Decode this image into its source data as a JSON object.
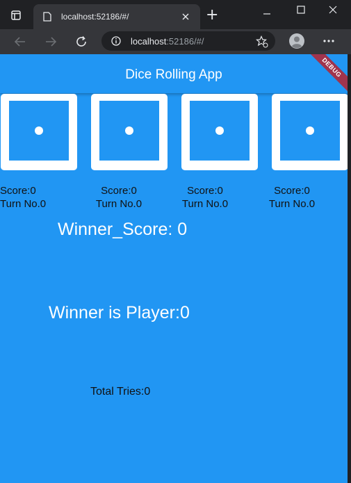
{
  "browser": {
    "tab_title": "localhost:52186/#/",
    "url_host": "localhost",
    "url_path": ":52186/#/",
    "new_tab_glyph": "+",
    "icons": [
      "window-icon",
      "favicon-globe-icon",
      "close-tab-icon",
      "new-tab-icon",
      "minimize-icon",
      "maximize-icon",
      "close-window-icon",
      "back-icon",
      "forward-icon",
      "reload-icon",
      "site-info-icon",
      "favorite-star-icon",
      "profile-avatar-icon",
      "more-menu-icon"
    ]
  },
  "app": {
    "title": "Dice Rolling App",
    "debug_banner": "DEBUG",
    "players": [
      {
        "score": "Score:0",
        "turn": "Turn No.0"
      },
      {
        "score": "Score:0",
        "turn": "Turn No.0"
      },
      {
        "score": "Score:0",
        "turn": "Turn No.0"
      },
      {
        "score": "Score:0",
        "turn": "Turn No.0"
      }
    ],
    "winner_score": "Winner_Score: 0",
    "winner": "Winner is Player:0",
    "total_tries": "Total Tries:0"
  },
  "colors": {
    "app_blue": "#2196f3",
    "chrome_dark": "#202124",
    "chrome_toolbar": "#35363a",
    "debug_banner": "#a0344d"
  }
}
